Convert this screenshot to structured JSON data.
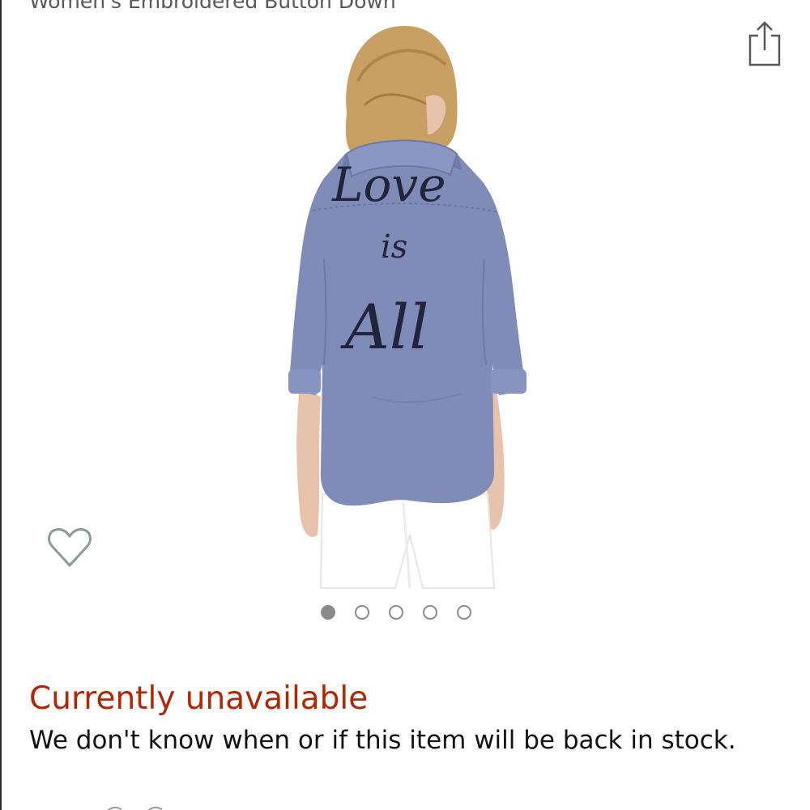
{
  "product": {
    "title": "Women's Embroidered Button Down",
    "image_alt": "Woman wearing a chambray button-down shirt with embroidered lettering on the back",
    "embroidery_text": [
      "Love",
      "is",
      "All"
    ]
  },
  "toolbar": {
    "share_icon": "share-icon",
    "favorite_icon": "heart-outline-icon"
  },
  "gallery": {
    "image_count": 5,
    "active_index": 0
  },
  "availability": {
    "status": "Currently unavailable",
    "message": "We don't know when or if this item will be back in stock."
  },
  "colors": {
    "status_red": "#b12704",
    "title_gray": "#565959",
    "dot_gray": "#8a8a8a",
    "shirt_blue": "#7f8cb8"
  }
}
